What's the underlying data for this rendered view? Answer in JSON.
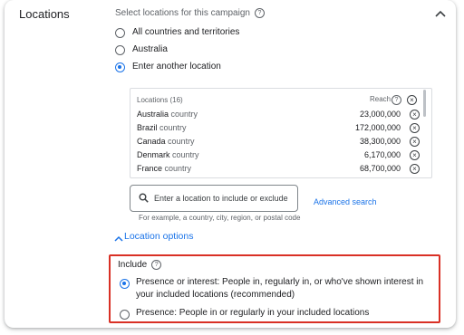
{
  "section": {
    "title": "Locations"
  },
  "subtitle": "Select locations for this campaign",
  "radio_options": [
    {
      "label": "All countries and territories",
      "selected": false
    },
    {
      "label": "Australia",
      "selected": false
    },
    {
      "label": "Enter another location",
      "selected": true
    }
  ],
  "locations": {
    "header": "Locations (16)",
    "reach_header": "Reach",
    "rows": [
      {
        "name": "Australia",
        "type": "country",
        "reach": "23,000,000"
      },
      {
        "name": "Brazil",
        "type": "country",
        "reach": "172,000,000"
      },
      {
        "name": "Canada",
        "type": "country",
        "reach": "38,300,000"
      },
      {
        "name": "Denmark",
        "type": "country",
        "reach": "6,170,000"
      },
      {
        "name": "France",
        "type": "country",
        "reach": "68,700,000"
      }
    ]
  },
  "search": {
    "placeholder": "Enter a location to include or exclude",
    "helper": "For example, a country, city, region, or postal code"
  },
  "advanced_search": "Advanced search",
  "location_options": "Location options",
  "include": {
    "label": "Include",
    "options": [
      {
        "line1": "Presence or interest: People in, regularly in, or who've shown interest in",
        "line2": "your included locations (recommended)",
        "selected": true
      },
      {
        "line1": "Presence: People in or regularly in your included locations",
        "line2": "",
        "selected": false
      }
    ]
  },
  "colors": {
    "accent": "#1a73e8",
    "highlight_border": "#d93025"
  }
}
